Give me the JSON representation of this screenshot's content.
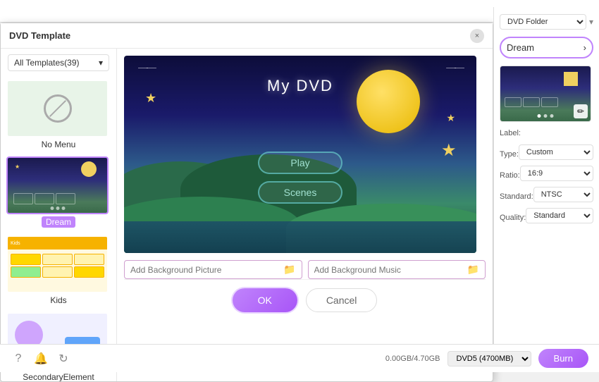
{
  "dialog": {
    "title": "DVD Template",
    "close_label": "×"
  },
  "template_dropdown": {
    "label": "All Templates(39)",
    "chevron": "▾"
  },
  "templates": [
    {
      "id": "nomenu",
      "label": "No Menu",
      "selected": false
    },
    {
      "id": "dream",
      "label": "Dream",
      "selected": true
    },
    {
      "id": "kids",
      "label": "Kids",
      "selected": false
    },
    {
      "id": "secondaryelement",
      "label": "SecondaryElement",
      "selected": false
    }
  ],
  "preview": {
    "title": "My DVD",
    "play_btn": "Play",
    "scenes_btn": "Scenes"
  },
  "inputs": {
    "background_picture_placeholder": "Add Background Picture",
    "background_music_placeholder": "Add Background Music"
  },
  "buttons": {
    "ok": "OK",
    "cancel": "Cancel"
  },
  "right_panel": {
    "output_label": "DVD Folder",
    "selected_template": "Dream",
    "chevron": "›",
    "label_field": "Label:",
    "type_label": "Type:",
    "type_value": "Custom",
    "ratio_label": "Ratio:",
    "ratio_value": "16:9",
    "standard_label": "Standard:",
    "standard_value": "NTSC",
    "quality_label": "Quality:",
    "quality_value": "Standard"
  },
  "bottom_bar": {
    "disk_info": "0.00GB/4.70GB",
    "disk_type": "DVD5 (4700MB)",
    "burn_label": "Burn"
  },
  "window_controls": {
    "minimize": "—",
    "maximize": "□",
    "close": "✕"
  }
}
